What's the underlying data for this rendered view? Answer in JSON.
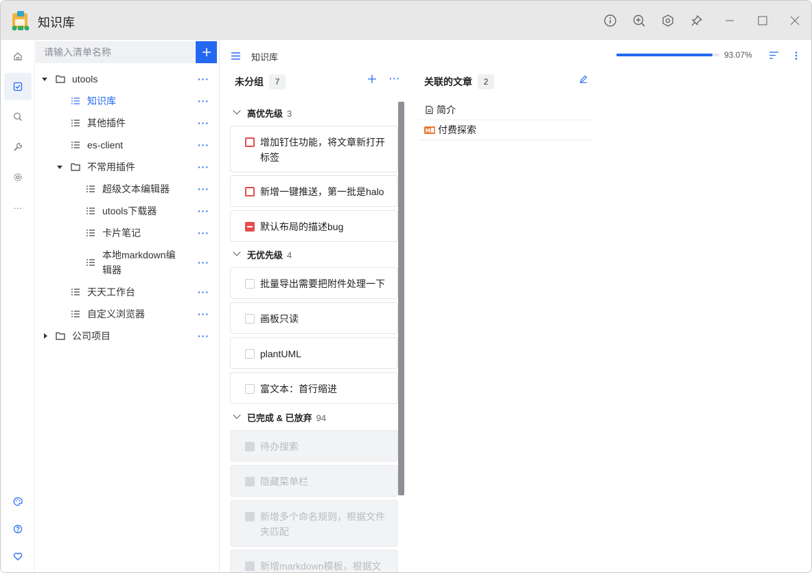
{
  "app": {
    "title": "知识库"
  },
  "titlebar_buttons": [
    "info-icon",
    "zoom-in-icon",
    "settings-hex-icon",
    "pin-icon",
    "minimize-icon",
    "maximize-icon",
    "close-icon"
  ],
  "rail": {
    "top": [
      "home-icon",
      "checklist-icon",
      "search-icon",
      "wrench-icon",
      "gear-icon",
      "more-icon"
    ],
    "bottom": [
      "palette-icon",
      "help-icon",
      "heart-icon"
    ],
    "active": "checklist-icon"
  },
  "search": {
    "placeholder": "请输入清单名称"
  },
  "tree": {
    "utools": "utools",
    "knowledge": "知识库",
    "other": "其他插件",
    "esclient": "es-client",
    "uncommon": "不常用插件",
    "rich": "超级文本编辑器",
    "utdl": "utools下载器",
    "card": "卡片笔记",
    "md1": "本地markdown编",
    "md2": "辑器",
    "daily": "天天工作台",
    "browser": "自定义浏览器",
    "company": "公司项目",
    "more": "···"
  },
  "main": {
    "crumb": "知识库",
    "progress_percent": 93.07,
    "progress_label": "93.07%",
    "todo_col": {
      "title": "未分组",
      "count": "7"
    },
    "groups": {
      "high": {
        "title": "高优先级",
        "count": "3"
      },
      "none": {
        "title": "无优先级",
        "count": "4"
      },
      "done": {
        "title": "已完成 & 已放弃",
        "count": "94"
      }
    },
    "tasks": {
      "t1a": "增加钉住功能，将文章新打开",
      "t1b": "标签",
      "t2": "新增一键推送，第一批是halo",
      "t3": "默认布局的描述bug",
      "t4": "批量导出需要把附件处理一下",
      "t5": "画板只读",
      "t6": "plantUML",
      "t7": "富文本：首行缩进",
      "d1": "待办搜索",
      "d2": "隐藏菜单栏",
      "d3a": "新增多个命名规则，根据文件",
      "d3b": "夹匹配",
      "d4": "新增markdown模板，根据文"
    },
    "articles_col": {
      "title": "关联的文章",
      "count": "2"
    },
    "articles": {
      "a1": "简介",
      "a2": "付费探索"
    }
  },
  "colors": {
    "accent": "#2468f2",
    "high_priority": "#e34d4d"
  }
}
